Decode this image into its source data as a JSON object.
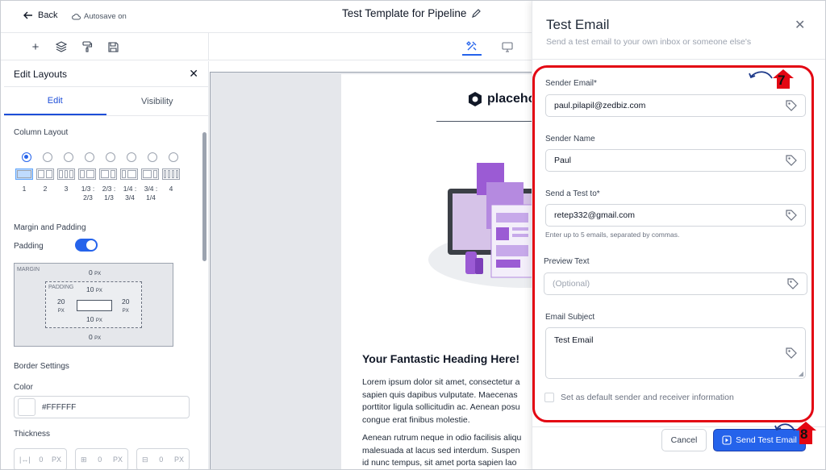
{
  "topbar": {
    "back_label": "Back",
    "autosave_label": "Autosave on",
    "title": "Test Template for Pipeline"
  },
  "left_panel": {
    "title": "Edit Layouts",
    "tabs": [
      "Edit",
      "Visibility"
    ],
    "active_tab": "Edit",
    "column_layout_label": "Column Layout",
    "column_options": [
      "1",
      "2",
      "3",
      "1/3 : 2/3",
      "2/3 : 1/3",
      "1/4 : 3/4",
      "3/4 : 1/4",
      "4"
    ],
    "selected_column_option": "1",
    "margin_padding_label": "Margin and Padding",
    "padding_label": "Padding",
    "padding_enabled": true,
    "spacing": {
      "margin_label": "MARGIN",
      "padding_label": "PADDING",
      "margin_top": "0",
      "margin_bottom": "0",
      "padding_top": "10",
      "padding_bottom": "10",
      "padding_left": "20",
      "padding_right": "20",
      "unit": "PX"
    },
    "border_settings_label": "Border Settings",
    "color_label": "Color",
    "color_value": "#FFFFFF",
    "thickness_label": "Thickness",
    "thickness_values": [
      "0",
      "0",
      "0"
    ],
    "thickness_unit": "PX"
  },
  "email_preview": {
    "logo_text": "placeho",
    "heading": "Your Fantastic Heading Here!",
    "paragraph_1": "Lorem ipsum dolor sit amet, consectetur a\nsapien quis dapibus vulputate. Maecenas\nporttitor ligula sollicitudin ac. Aenean posu\ncongue erat finibus molestie.",
    "paragraph_2": "Aenean rutrum neque in odio facilisis aliqu\nmalesuada at lacus sed interdum. Suspen\nid nunc tempus, sit amet porta sapien lao"
  },
  "modal": {
    "title": "Test Email",
    "subtitle": "Send a test email to your own inbox or someone else's",
    "sender_email_label": "Sender Email*",
    "sender_email_value": "paul.pilapil@zedbiz.com",
    "sender_name_label": "Sender Name",
    "sender_name_value": "Paul",
    "send_to_label": "Send a Test to*",
    "send_to_value": "retep332@gmail.com",
    "send_to_help": "Enter up to 5 emails, separated by commas.",
    "preview_text_label": "Preview Text",
    "preview_text_placeholder": "(Optional)",
    "email_subject_label": "Email Subject",
    "email_subject_value": "Test Email",
    "default_checkbox_label": "Set as default sender and receiver information",
    "default_checked": false,
    "cancel_label": "Cancel",
    "send_label": "Send Test Email"
  },
  "annotations": {
    "step_a": "7",
    "step_b": "8",
    "highlight_color": "#e30613"
  },
  "colors": {
    "accent": "#2563eb",
    "text": "#1f2937",
    "muted": "#9ca3af"
  }
}
